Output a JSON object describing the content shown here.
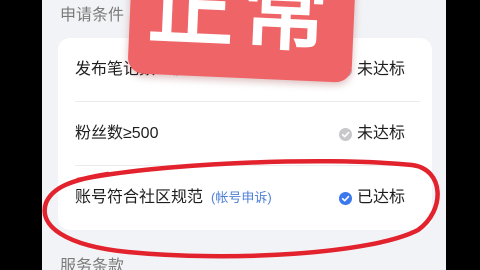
{
  "stamp": {
    "text": "正常"
  },
  "conditions": {
    "title": "申请条件",
    "items": [
      {
        "label": "发布笔记数≥2篇",
        "status": "未达标",
        "met": false,
        "icon": "check-circle-icon"
      },
      {
        "label": "粉丝数≥500",
        "status": "未达标",
        "met": false,
        "icon": "check-circle-icon"
      },
      {
        "label": "账号符合社区规范",
        "link": "(帐号申诉)",
        "status": "已达标",
        "met": true,
        "icon": "check-circle-icon"
      }
    ]
  },
  "terms": {
    "title": "服务条款"
  },
  "colors": {
    "page_bg": "#f2f3f6",
    "card_bg": "#ffffff",
    "text": "#1e1e1e",
    "section_title": "#7b7b7b",
    "divider": "#ececee",
    "check_off": "#c8c8cc",
    "check_on": "#3a78f0",
    "link": "#4d7fd6",
    "stamp": "#ef6467",
    "annotation": "#e2222d"
  }
}
